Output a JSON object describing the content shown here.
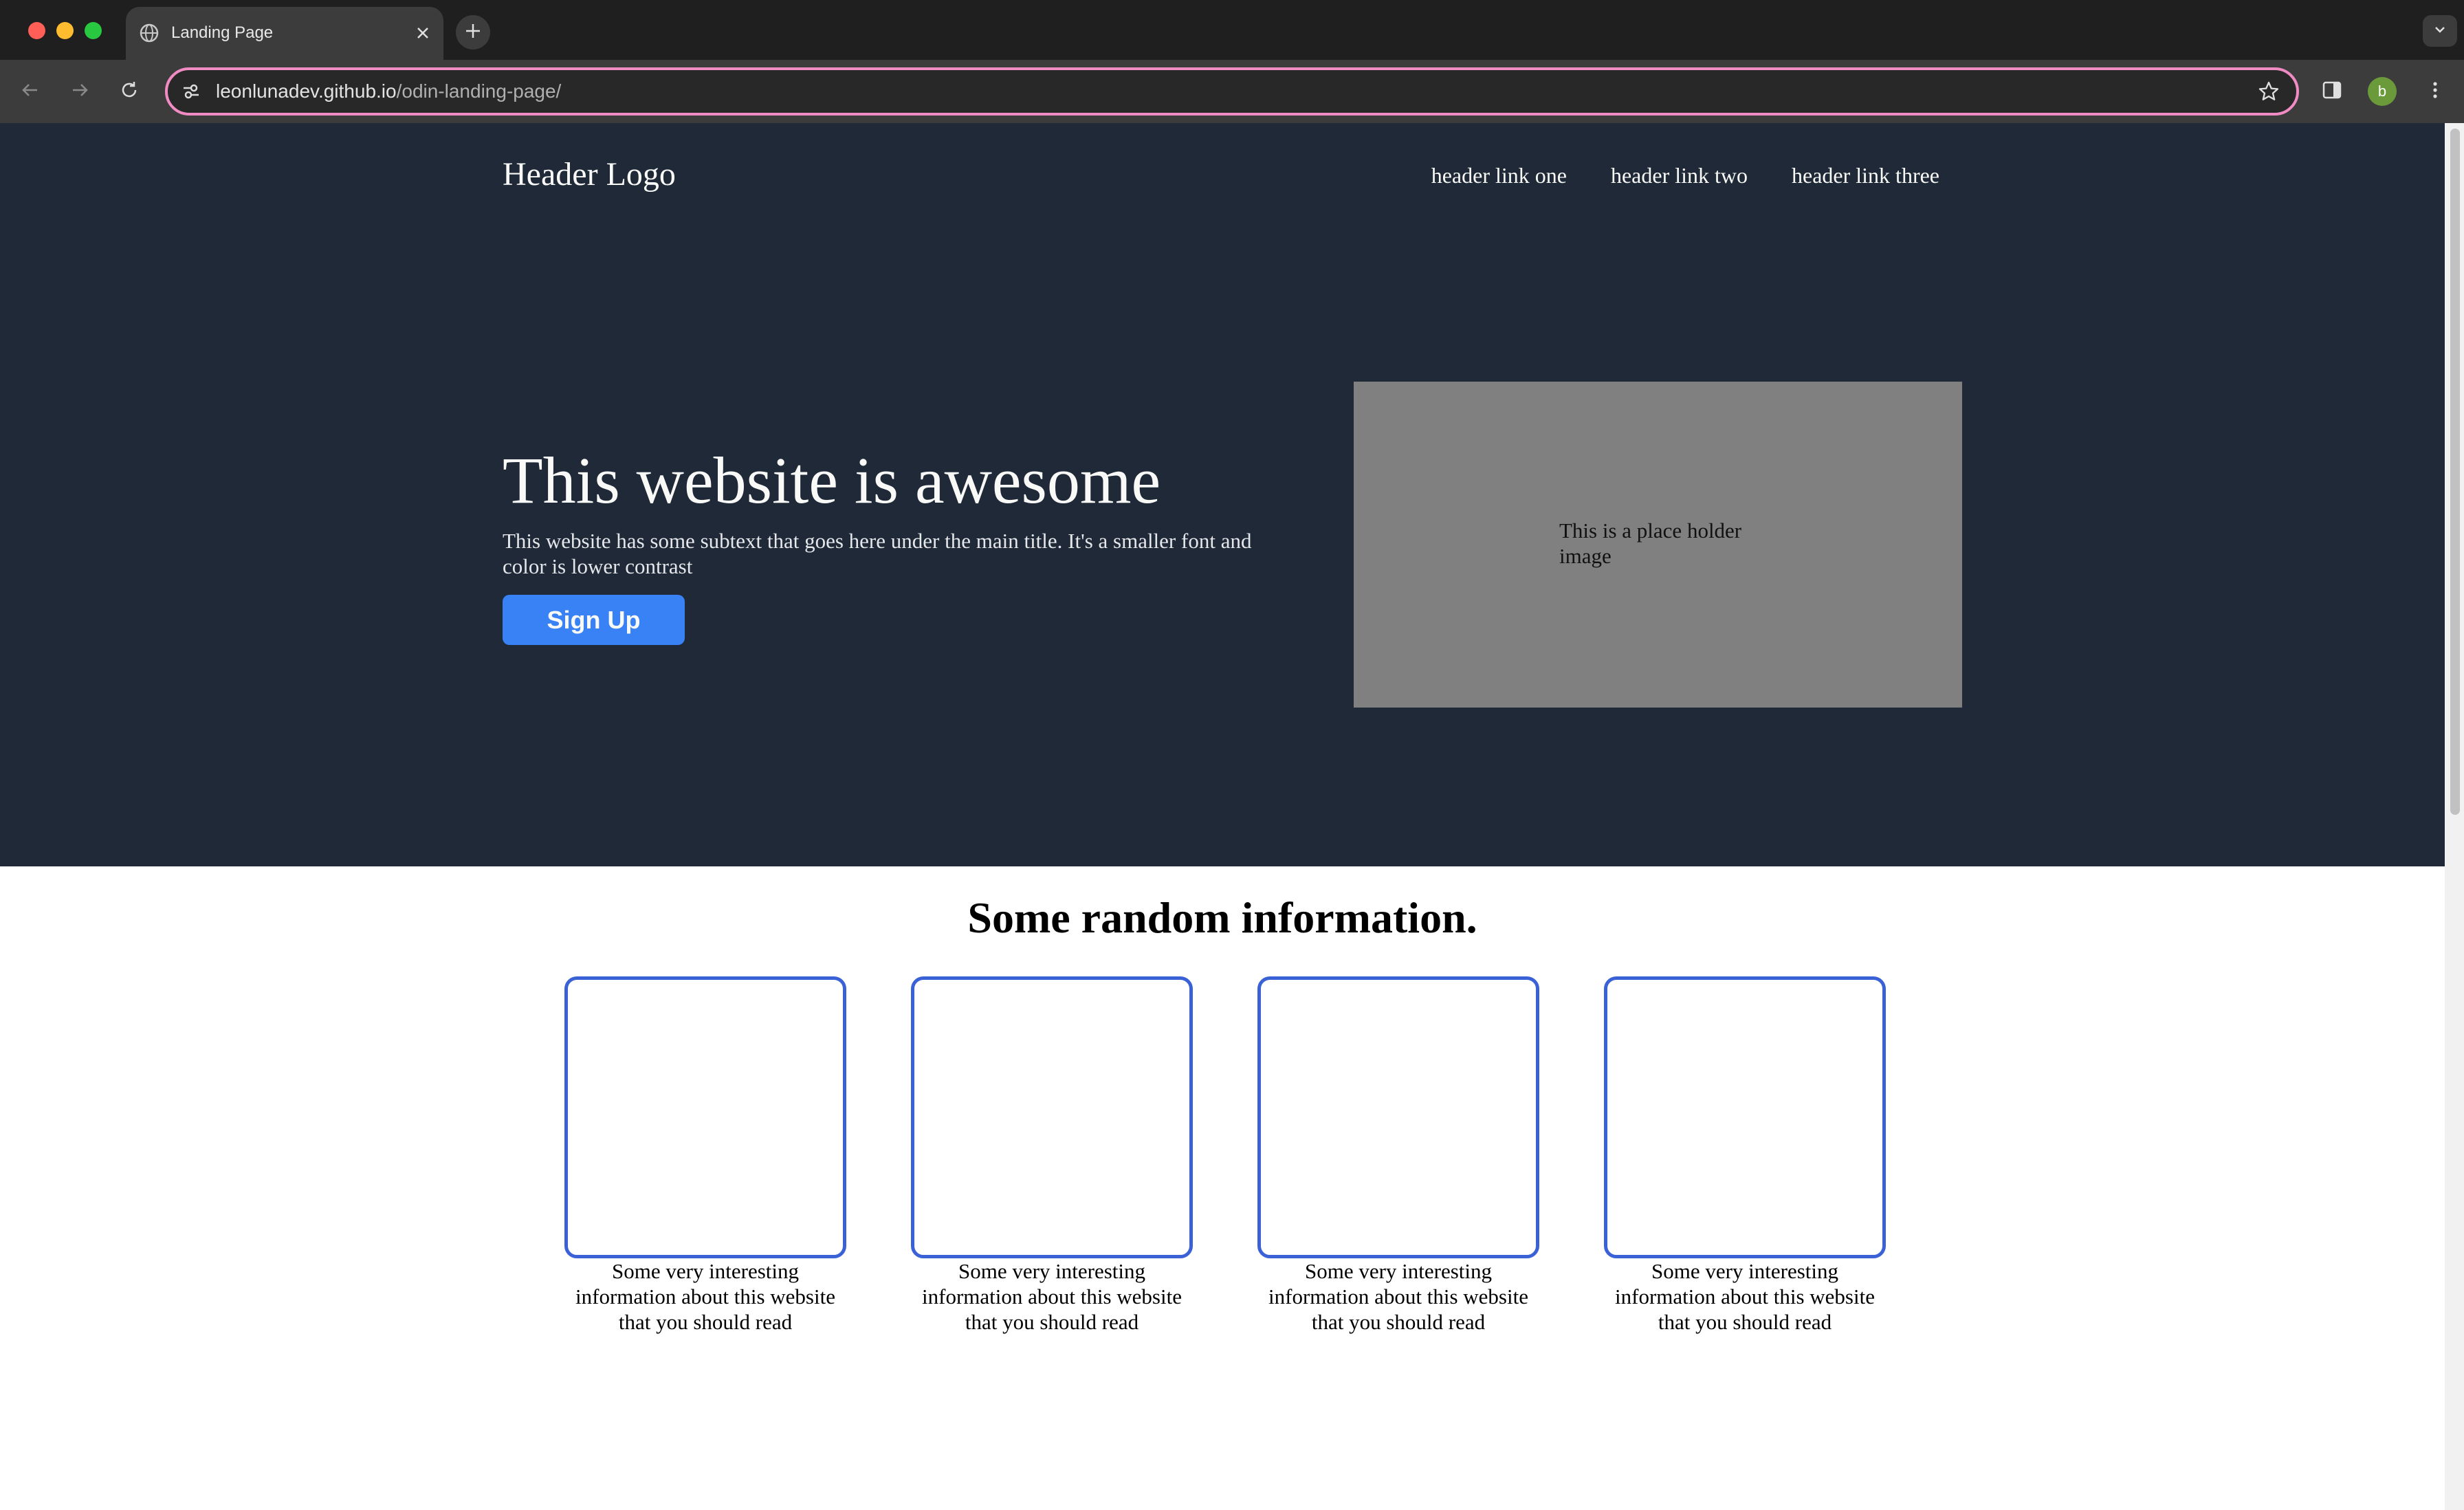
{
  "browser": {
    "tab_title": "Landing Page",
    "url_host": "leonlunadev.github.io",
    "url_path": "/odin-landing-page/",
    "profile_initial": "b",
    "icons": [
      "globe-icon",
      "close-icon",
      "plus-icon",
      "chevron-down-icon",
      "back-arrow-icon",
      "forward-arrow-icon",
      "reload-icon",
      "site-settings-icon",
      "star-icon",
      "side-panel-icon",
      "kebab-menu-icon"
    ],
    "colors": {
      "omnibox_focus_ring": "#f08cc3",
      "avatar": "#6b9a3a"
    }
  },
  "page": {
    "header": {
      "logo": "Header Logo",
      "links": [
        "header link one",
        "header link two",
        "header link three"
      ]
    },
    "hero": {
      "title": "This website is awesome",
      "subtext": "This website has some subtext that goes here under the main title. It's a smaller font and color is lower contrast",
      "signup_label": "Sign Up",
      "placeholder_text": "This is a place holder image"
    },
    "info": {
      "title": "Some random information.",
      "cards": [
        {
          "text": "Some very interesting information about this website that you should read"
        },
        {
          "text": "Some very interesting information about this website that you should read"
        },
        {
          "text": "Some very interesting information about this website that you should read"
        },
        {
          "text": "Some very interesting information about this website that you should read"
        }
      ]
    },
    "colors": {
      "hero_bg": "#1f2937",
      "button": "#3882f6",
      "card_border": "#3a62d6",
      "placeholder_bg": "#808080"
    }
  }
}
